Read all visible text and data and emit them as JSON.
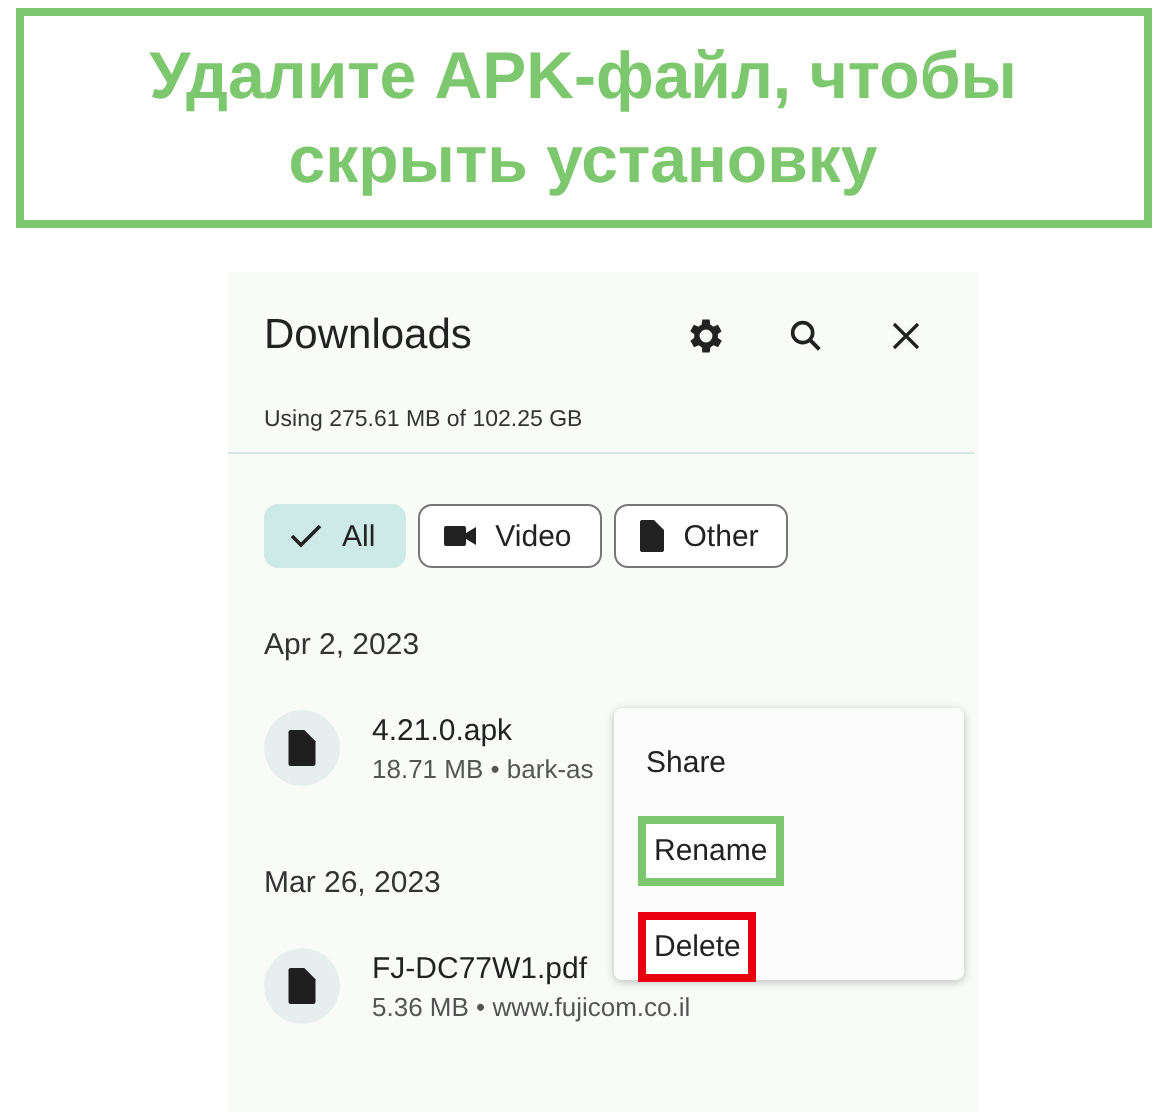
{
  "banner": {
    "title": "Удалите APK-файл, чтобы скрыть установку"
  },
  "header": {
    "title": "Downloads",
    "storage": "Using 275.61 MB of 102.25 GB"
  },
  "filters": [
    {
      "label": "All",
      "selected": true
    },
    {
      "label": "Video",
      "selected": false
    },
    {
      "label": "Other",
      "selected": false
    }
  ],
  "groups": [
    {
      "date": "Apr 2, 2023",
      "files": [
        {
          "name": "4.21.0.apk",
          "details": "18.71 MB • bark-as"
        }
      ]
    },
    {
      "date": "Mar 26, 2023",
      "files": [
        {
          "name": "FJ-DC77W1.pdf",
          "details": "5.36 MB • www.fujicom.co.il"
        }
      ]
    }
  ],
  "context_menu": {
    "items": [
      {
        "label": "Share"
      },
      {
        "label": "Rename",
        "color": "#7dc86f"
      },
      {
        "label": "Delete",
        "color": "#e8000e"
      }
    ]
  }
}
